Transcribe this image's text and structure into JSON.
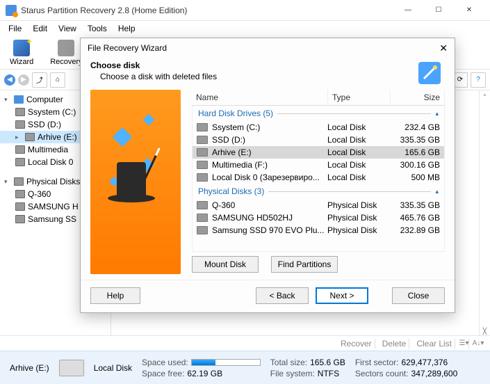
{
  "window": {
    "title": "Starus Partition Recovery 2.8 (Home Edition)"
  },
  "menu": {
    "file": "File",
    "edit": "Edit",
    "view": "View",
    "tools": "Tools",
    "help": "Help"
  },
  "toolbar": {
    "wizard": "Wizard",
    "recovery": "Recovery"
  },
  "tree": {
    "computer": "Computer",
    "items": [
      {
        "label": "Ssystem (C:)"
      },
      {
        "label": "SSD (D:)"
      },
      {
        "label": "Arhive (E:)"
      },
      {
        "label": "Multimedia"
      },
      {
        "label": "Local Disk 0"
      }
    ],
    "physical": "Physical Disks",
    "phys_items": [
      {
        "label": "Q-360"
      },
      {
        "label": "SAMSUNG H"
      },
      {
        "label": "Samsung SS"
      }
    ]
  },
  "dialog": {
    "title": "File Recovery Wizard",
    "heading": "Choose disk",
    "subheading": "Choose a disk with deleted files",
    "cols": {
      "name": "Name",
      "type": "Type",
      "size": "Size"
    },
    "group_hdd": "Hard Disk Drives (5)",
    "group_phys": "Physical Disks (3)",
    "hdd": [
      {
        "name": "Ssystem (C:)",
        "type": "Local Disk",
        "size": "232.4 GB"
      },
      {
        "name": "SSD (D:)",
        "type": "Local Disk",
        "size": "335.35 GB"
      },
      {
        "name": "Arhive (E:)",
        "type": "Local Disk",
        "size": "165.6 GB",
        "selected": true
      },
      {
        "name": "Multimedia (F:)",
        "type": "Local Disk",
        "size": "300.16 GB"
      },
      {
        "name": "Local Disk 0 (Зарезервиро...",
        "type": "Local Disk",
        "size": "500 MB"
      }
    ],
    "phys": [
      {
        "name": "Q-360",
        "type": "Physical Disk",
        "size": "335.35 GB"
      },
      {
        "name": "SAMSUNG HD502HJ",
        "type": "Physical Disk",
        "size": "465.76 GB"
      },
      {
        "name": "Samsung SSD 970 EVO Plu...",
        "type": "Physical Disk",
        "size": "232.89 GB"
      }
    ],
    "mount": "Mount Disk",
    "find": "Find Partitions",
    "help": "Help",
    "back": "< Back",
    "next": "Next >",
    "close": "Close"
  },
  "status": {
    "recover": "Recover",
    "delete": "Delete",
    "clear": "Clear List"
  },
  "bottom": {
    "drive_name": "Arhive (E:)",
    "drive_type": "Local Disk",
    "used_label": "Space used:",
    "free_label": "Space free:",
    "free_value": "62.19 GB",
    "total_label": "Total size:",
    "total_value": "165.6 GB",
    "fs_label": "File system:",
    "fs_value": "NTFS",
    "first_label": "First sector:",
    "first_value": "629,477,376",
    "sectors_label": "Sectors count:",
    "sectors_value": "347,289,600"
  }
}
